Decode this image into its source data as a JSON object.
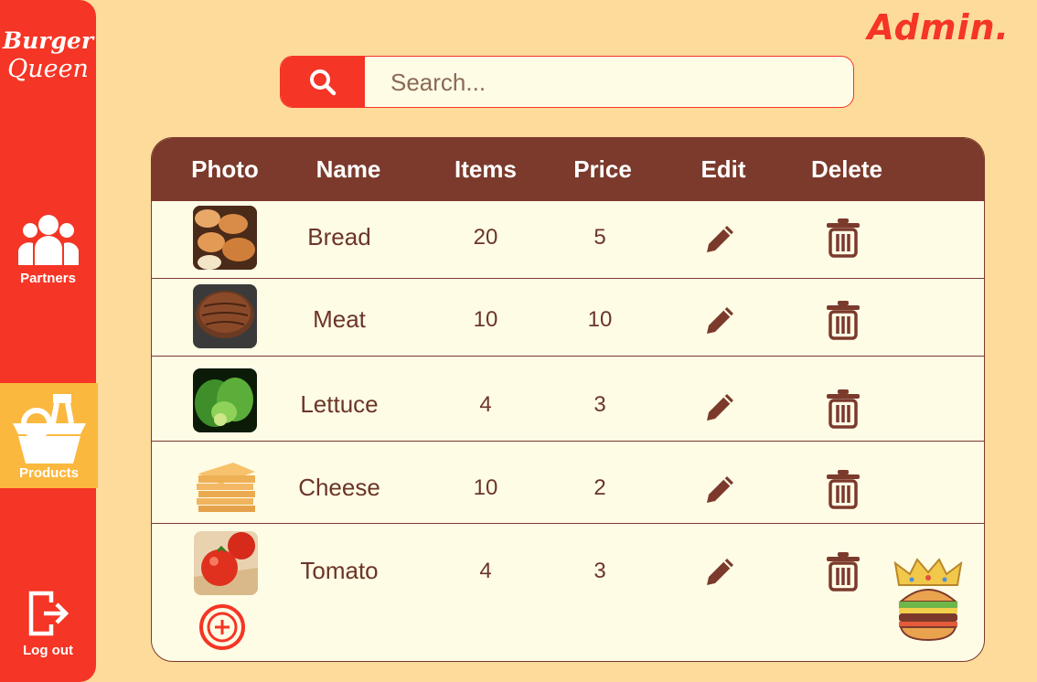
{
  "brand": {
    "line1": "Burger",
    "line2": "Queen"
  },
  "nav": {
    "partners": {
      "label": "Partners",
      "icon": "users-icon"
    },
    "products": {
      "label": "Products",
      "icon": "basket-icon",
      "active": true
    },
    "logout": {
      "label": "Log out",
      "icon": "logout-icon"
    }
  },
  "header": {
    "admin_label": "Admin."
  },
  "search": {
    "placeholder": "Search...",
    "value": ""
  },
  "table": {
    "columns": [
      "Photo",
      "Name",
      "Items",
      "Price",
      "Edit",
      "Delete"
    ],
    "rows": [
      {
        "name": "Bread",
        "items": "20",
        "price": "5",
        "photo": "bread-photo"
      },
      {
        "name": "Meat",
        "items": "10",
        "price": "10",
        "photo": "meat-photo"
      },
      {
        "name": "Lettuce",
        "items": "4",
        "price": "3",
        "photo": "lettuce-photo"
      },
      {
        "name": "Cheese",
        "items": "10",
        "price": "2",
        "photo": "cheese-photo"
      },
      {
        "name": "Tomato",
        "items": "4",
        "price": "3",
        "photo": "tomato-photo"
      }
    ]
  },
  "colors": {
    "primary": "#F53525",
    "brown": "#7B3A2C",
    "cream": "#FFFCE6",
    "background": "#FDDB9B",
    "active": "#FBB83E"
  }
}
